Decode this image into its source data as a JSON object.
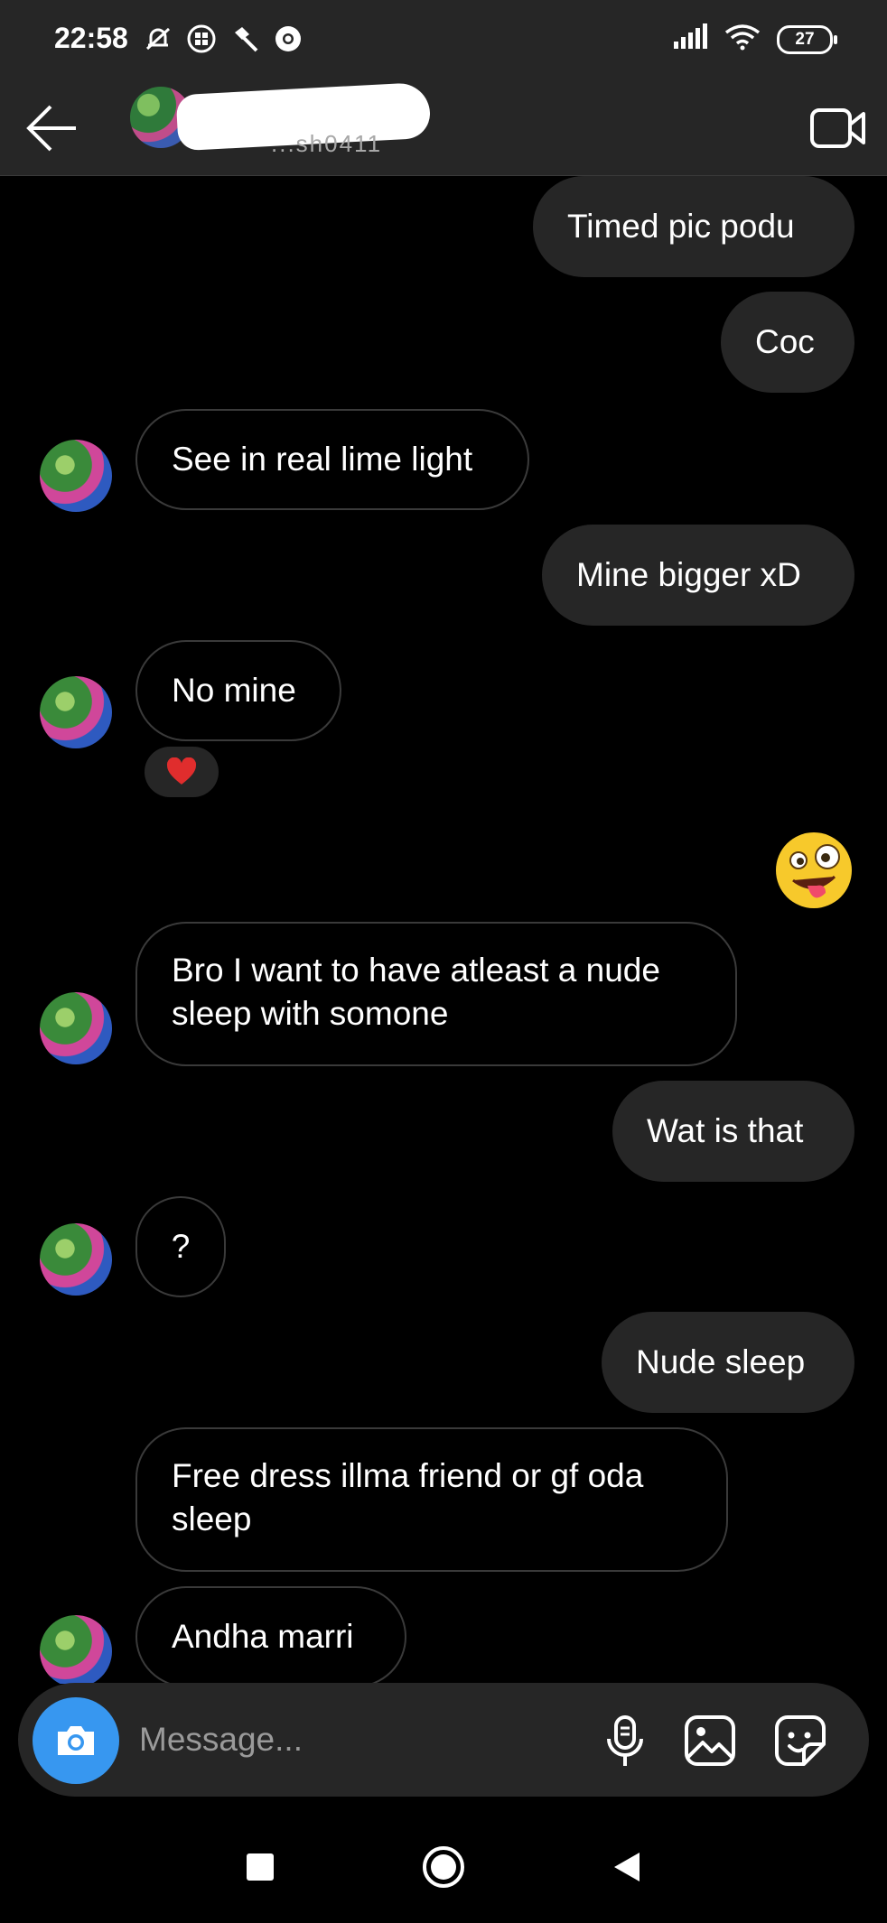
{
  "status_bar": {
    "time": "22:58",
    "battery": "27"
  },
  "header": {
    "subname": "...sh0411",
    "back_icon": "arrow-left-icon",
    "video_icon": "video-call-icon"
  },
  "messages": [
    {
      "direction": "outgoing",
      "text": "Timed pic podu"
    },
    {
      "direction": "outgoing",
      "text": "Coc"
    },
    {
      "direction": "incoming",
      "text": "See in real lime light"
    },
    {
      "direction": "outgoing",
      "text": "Mine bigger xD"
    },
    {
      "direction": "incoming",
      "text": "No mine",
      "reaction": "❤️"
    },
    {
      "direction": "outgoing",
      "text": "🤪",
      "type": "emoji"
    },
    {
      "direction": "incoming",
      "text": "Bro I want to have atleast a nude sleep with somone"
    },
    {
      "direction": "outgoing",
      "text": "Wat is that"
    },
    {
      "direction": "incoming",
      "text": "?"
    },
    {
      "direction": "outgoing",
      "text": "Nude sleep"
    },
    {
      "direction": "incoming",
      "text": "Free dress illma friend or gf oda sleep"
    },
    {
      "direction": "incoming",
      "text": "Andha marri"
    }
  ],
  "composer": {
    "placeholder": "Message...",
    "icons": [
      "camera-icon",
      "microphone-icon",
      "gallery-icon",
      "sticker-icon"
    ]
  },
  "nav": {
    "icons": [
      "recent-apps-icon",
      "home-icon",
      "back-nav-icon"
    ]
  },
  "colors": {
    "background": "#000000",
    "bar": "#262626",
    "outgoing_bubble": "#262626",
    "incoming_border": "#3a3a3a",
    "camera_accent": "#3797f0"
  }
}
